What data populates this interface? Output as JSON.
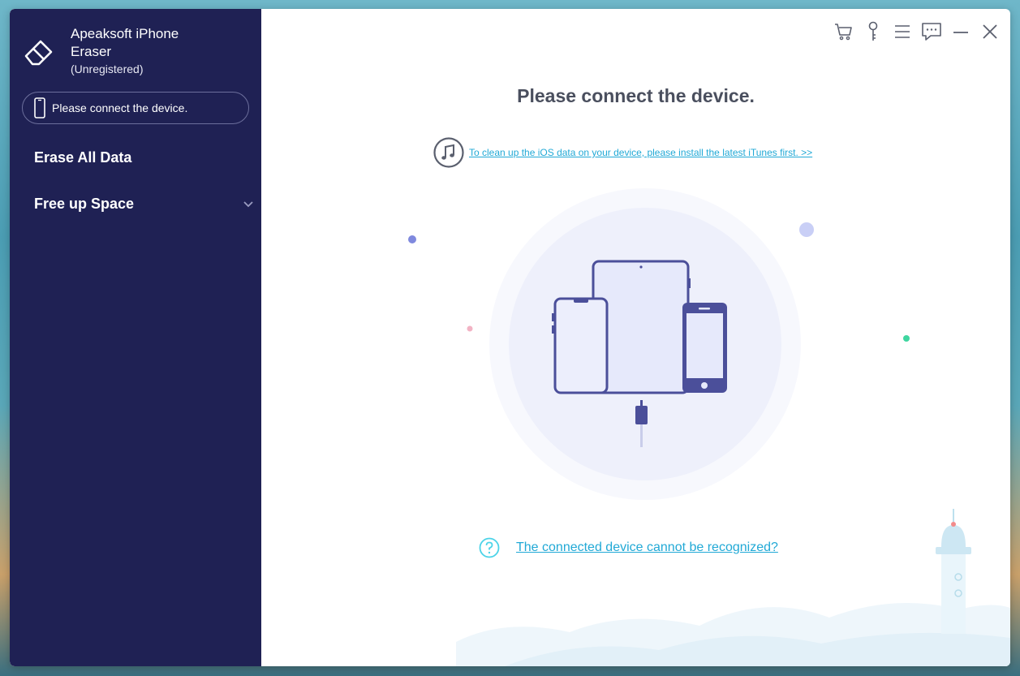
{
  "app": {
    "name": "Apeaksoft iPhone Eraser",
    "status": "(Unregistered)"
  },
  "sidebar": {
    "device_status": "Please connect the device.",
    "items": [
      {
        "label": "Erase All Data"
      },
      {
        "label": "Free up Space"
      }
    ]
  },
  "toolbar": {
    "icons": [
      "cart-icon",
      "key-icon",
      "menu-icon",
      "feedback-icon",
      "minimize-icon",
      "close-icon"
    ]
  },
  "main": {
    "title": "Please connect the device.",
    "itunes_link": "To clean up the iOS data on your device, please install the latest iTunes first. >>",
    "help_link": "The connected device cannot be recognized?"
  },
  "colors": {
    "sidebar_bg": "#1f2154",
    "accent": "#21a9d6",
    "device_stroke": "#4b4f9a",
    "device_fill": "#e9ebfb"
  }
}
